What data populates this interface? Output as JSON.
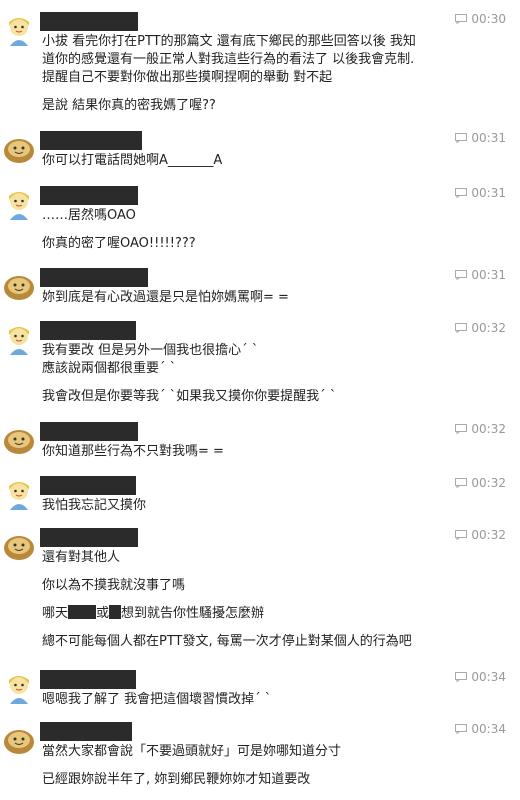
{
  "messages": [
    {
      "avatar": "girl-avatar",
      "time": "00:30",
      "lines": [
        "小拔 看完你打在PTT的那篇文 還有底下鄉民的那些回答以後 我知",
        "道你的感覺還有一般正常人對我這些行為的看法了 以後我會克制.",
        "提醒自己不要對你做出那些摸啊捏啊的舉動 對不起",
        "",
        "是說 結果你真的密我媽了喔??"
      ]
    },
    {
      "avatar": "boy-avatar",
      "time": "00:31",
      "lines": [
        "你可以打電話問她啊A_______A"
      ]
    },
    {
      "avatar": "girl-avatar",
      "time": "00:31",
      "lines": [
        "……居然嗎OAO",
        "",
        "你真的密了喔OAO!!!!!???"
      ]
    },
    {
      "avatar": "boy-avatar",
      "time": "00:31",
      "lines": [
        "妳到底是有心改過還是只是怕妳媽罵啊= ="
      ]
    },
    {
      "avatar": "girl-avatar",
      "time": "00:32",
      "lines": [
        "我有要改 但是另外一個我也很擔心ˊ ˋ",
        "應該說兩個都很重要ˊ ˋ",
        "",
        "我會改但是你要等我ˊ ˋ如果我又摸你你要提醒我ˊ ˋ"
      ]
    },
    {
      "avatar": "boy-avatar",
      "time": "00:32",
      "lines": [
        "你知道那些行為不只對我嗎= ="
      ]
    },
    {
      "avatar": "girl-avatar",
      "time": "00:32",
      "lines": [
        "我怕我忘記又摸你"
      ]
    },
    {
      "avatar": "boy-avatar",
      "time": "00:32",
      "lines": [
        "還有對其他人",
        "",
        "你以為不摸我就沒事了嗎",
        "",
        "哪天",
        "",
        "總不可能每個人都在PTT發文, 每罵一次才停止對某個人的行為吧"
      ],
      "redacted_line": {
        "before": "哪天",
        "middle": "或",
        "after": "想到就告你性騷擾怎麼辦"
      }
    },
    {
      "avatar": "girl-avatar",
      "time": "00:34",
      "lines": [
        "嗯嗯我了解了 我會把這個壞習慣改掉ˊ ˋ"
      ]
    },
    {
      "avatar": "boy-avatar",
      "time": "00:34",
      "lines": [
        "當然大家都會說「不要過頭就好」可是妳哪知道分寸",
        "",
        "已經跟妳說半年了, 妳到鄉民鞭妳妳才知道要改"
      ]
    }
  ]
}
